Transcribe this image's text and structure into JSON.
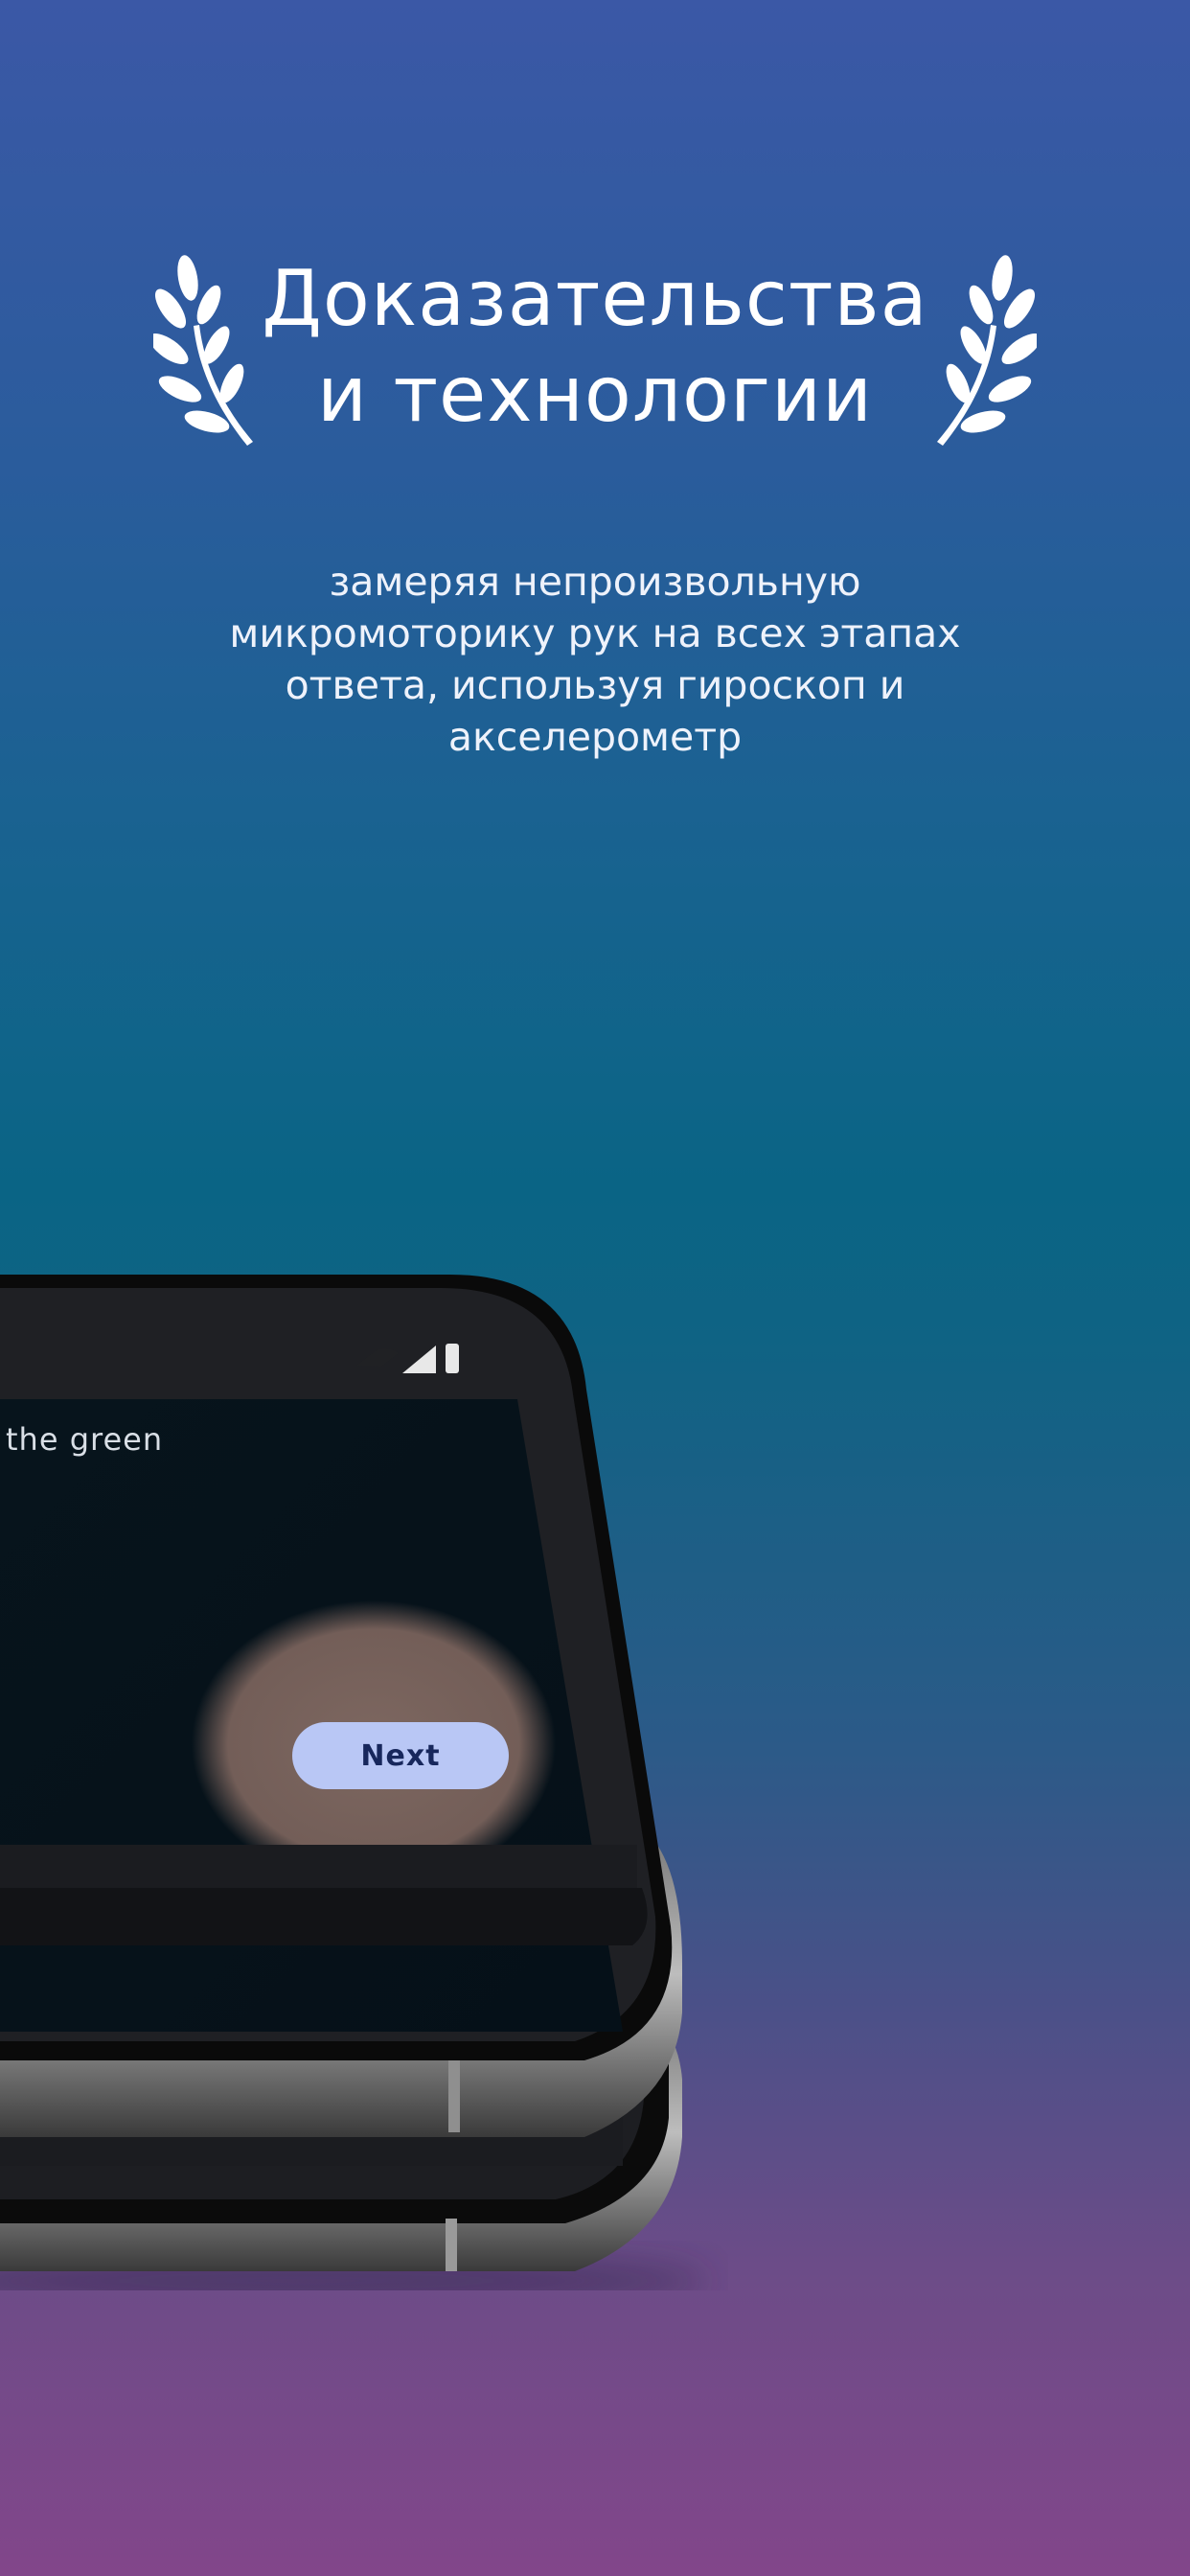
{
  "header": {
    "title_line1": "Доказательства",
    "title_line2": "и технологии",
    "laurel_icon": "laurel-wreath-icon"
  },
  "description": {
    "line1": "замеряя непроизвольную",
    "line2": "микромоторику рук на всех этапах",
    "line3": "ответа, используя гироскоп и",
    "line4": "акселерометр"
  },
  "phone": {
    "prompt_text": "the green",
    "next_button_label": "Next",
    "status_icons": [
      "wifi-icon",
      "signal-icon",
      "battery-icon"
    ]
  },
  "colors": {
    "gradient_top": "#3b58a6",
    "gradient_middle": "#0a6485",
    "gradient_bottom": "#82468a",
    "button_bg": "#b9c7f5",
    "button_text": "#17275c"
  }
}
